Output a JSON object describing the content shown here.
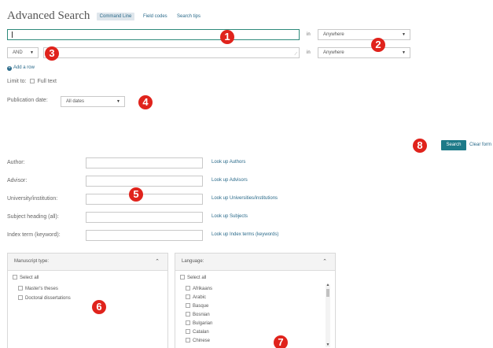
{
  "header": {
    "title": "Advanced Search",
    "tabs": [
      {
        "label": "Command Line",
        "active": true
      },
      {
        "label": "Field codes",
        "active": false
      },
      {
        "label": "Search tips",
        "active": false
      }
    ]
  },
  "search_rows": {
    "in_label": "in",
    "row1": {
      "value": "",
      "field": "Anywhere"
    },
    "row2": {
      "operator": "AND",
      "value": "",
      "field": "Anywhere"
    },
    "add_row": "Add a row"
  },
  "limit": {
    "label": "Limit to:",
    "full_text": "Full text"
  },
  "pubdate": {
    "label": "Publication date:",
    "value": "All dates"
  },
  "actions": {
    "search": "Search",
    "clear": "Clear form"
  },
  "fields": [
    {
      "label": "Author:",
      "lookup": "Look up Authors"
    },
    {
      "label": "Advisor:",
      "lookup": "Look up Advisors"
    },
    {
      "label": "University/institution:",
      "lookup": "Look up Universities/institutions"
    },
    {
      "label": "Subject heading (all):",
      "lookup": "Look up Subjects"
    },
    {
      "label": "Index term (keyword):",
      "lookup": "Look up Index terms (keywords)"
    }
  ],
  "manuscript": {
    "title": "Manuscript type:",
    "select_all": "Select all",
    "items": [
      "Master's theses",
      "Doctoral dissertations"
    ]
  },
  "language": {
    "title": "Language:",
    "select_all": "Select all",
    "items": [
      "Afrikaans",
      "Arabic",
      "Basque",
      "Bosnian",
      "Bulgarian",
      "Catalan",
      "Chinese"
    ]
  },
  "badges": [
    "1",
    "2",
    "3",
    "4",
    "5",
    "6",
    "7",
    "8"
  ],
  "colors": {
    "badge": "#e0231c",
    "link": "#2a6a8a",
    "button": "#1d7a88",
    "focus": "#2d8a7a"
  }
}
